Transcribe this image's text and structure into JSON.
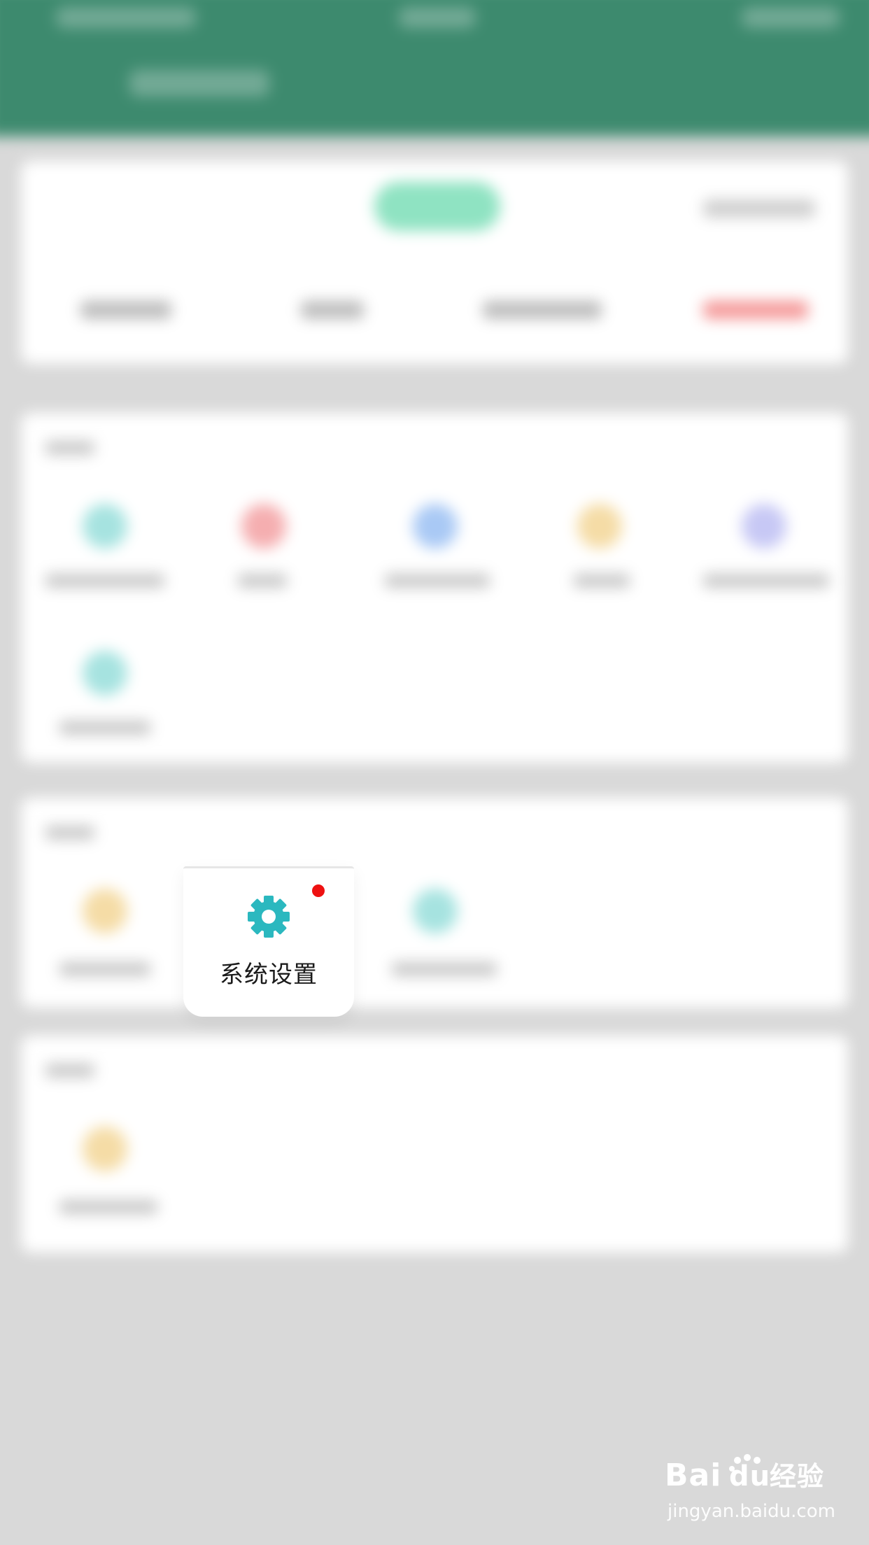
{
  "focused_tile": {
    "label": "系统设置",
    "icon": "gear-icon",
    "icon_color": "#2bb8bf",
    "badge_color": "#ee1111"
  },
  "watermark": {
    "logo": "Bai du 经验",
    "url": "jingyan.baidu.com"
  },
  "colors": {
    "header": "#3d8a6e",
    "background": "#d9d9d9",
    "card": "#ffffff",
    "accent_pill": "#8fe3c2"
  }
}
